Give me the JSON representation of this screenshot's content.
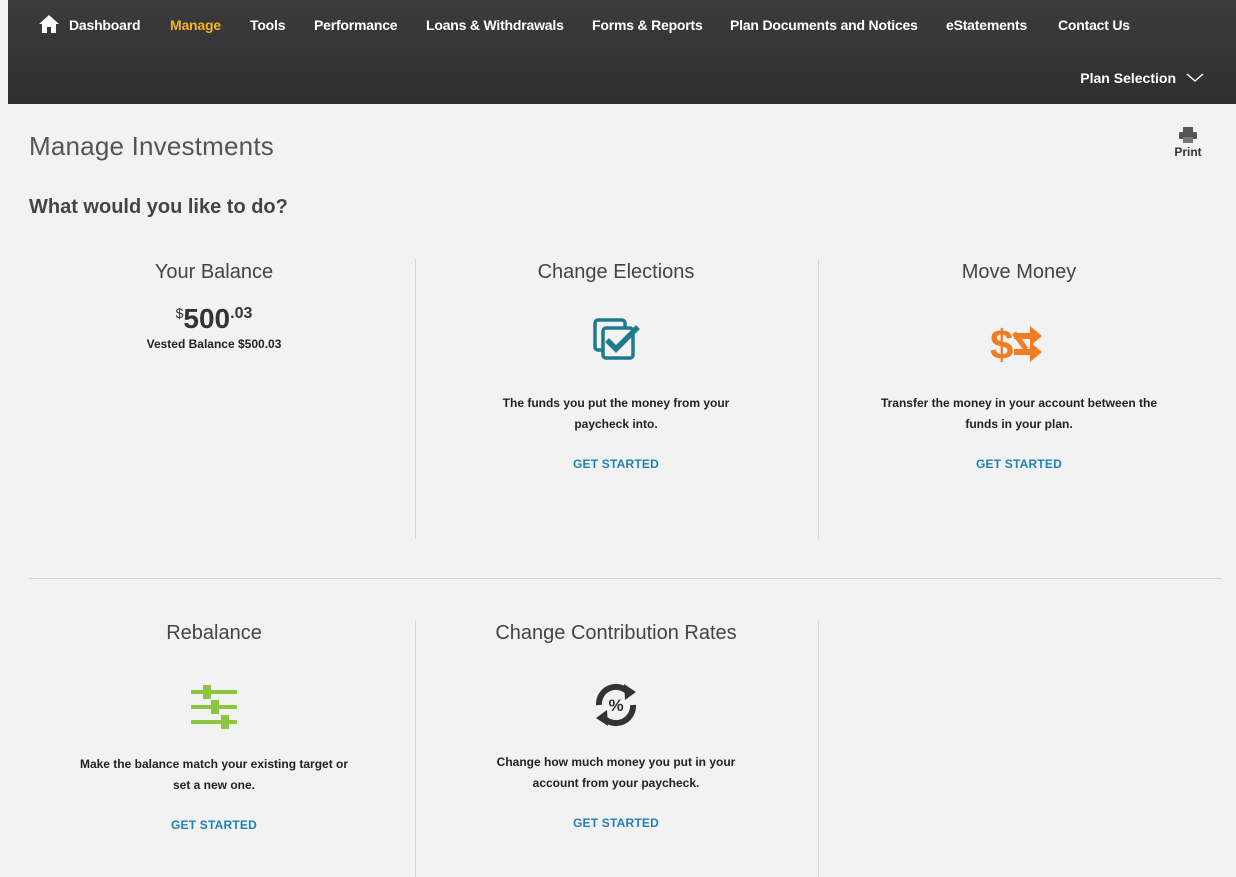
{
  "nav": {
    "items": [
      {
        "label": "Dashboard",
        "active": false
      },
      {
        "label": "Manage",
        "active": true
      },
      {
        "label": "Tools",
        "active": false
      },
      {
        "label": "Performance",
        "active": false
      },
      {
        "label": "Loans & Withdrawals",
        "active": false
      },
      {
        "label": "Forms & Reports",
        "active": false
      },
      {
        "label": "Plan Documents and Notices",
        "active": false
      },
      {
        "label": "eStatements",
        "active": false
      },
      {
        "label": "Contact Us",
        "active": false
      }
    ],
    "plan_selection": "Plan Selection",
    "icon": "home-icon",
    "active_color": "#f6b127"
  },
  "page": {
    "title": "Manage Investments",
    "print_label": "Print",
    "subtitle": "What would you like to do?"
  },
  "cards": {
    "balance": {
      "title": "Your Balance",
      "currency": "$",
      "whole": "500",
      "cents": ".03",
      "vested": "Vested Balance $500.03"
    },
    "change_elections": {
      "title": "Change Elections",
      "desc_line1": "The funds you put the money from your",
      "desc_line2": "paycheck into.",
      "cta": "GET STARTED",
      "icon": "checklist-icon",
      "icon_color": "#1d7b8c"
    },
    "move_money": {
      "title": "Move Money",
      "desc_line1": "Transfer the money in your account between the",
      "desc_line2": "funds in your plan.",
      "cta": "GET STARTED",
      "icon": "money-transfer-icon",
      "icon_color": "#f27c21"
    },
    "rebalance": {
      "title": "Rebalance",
      "desc_line1": "Make the balance match your existing target or",
      "desc_line2": "set a new one.",
      "cta": "GET STARTED",
      "icon": "sliders-icon",
      "icon_color": "#8cc63f"
    },
    "contribution_rates": {
      "title": "Change Contribution Rates",
      "desc_line1": "Change how much money you put in your",
      "desc_line2": "account from your paycheck.",
      "cta": "GET STARTED",
      "icon": "percent-cycle-icon",
      "icon_color": "#333333"
    }
  },
  "colors": {
    "link": "#1f7fb7",
    "nav_bg": "#333333"
  }
}
